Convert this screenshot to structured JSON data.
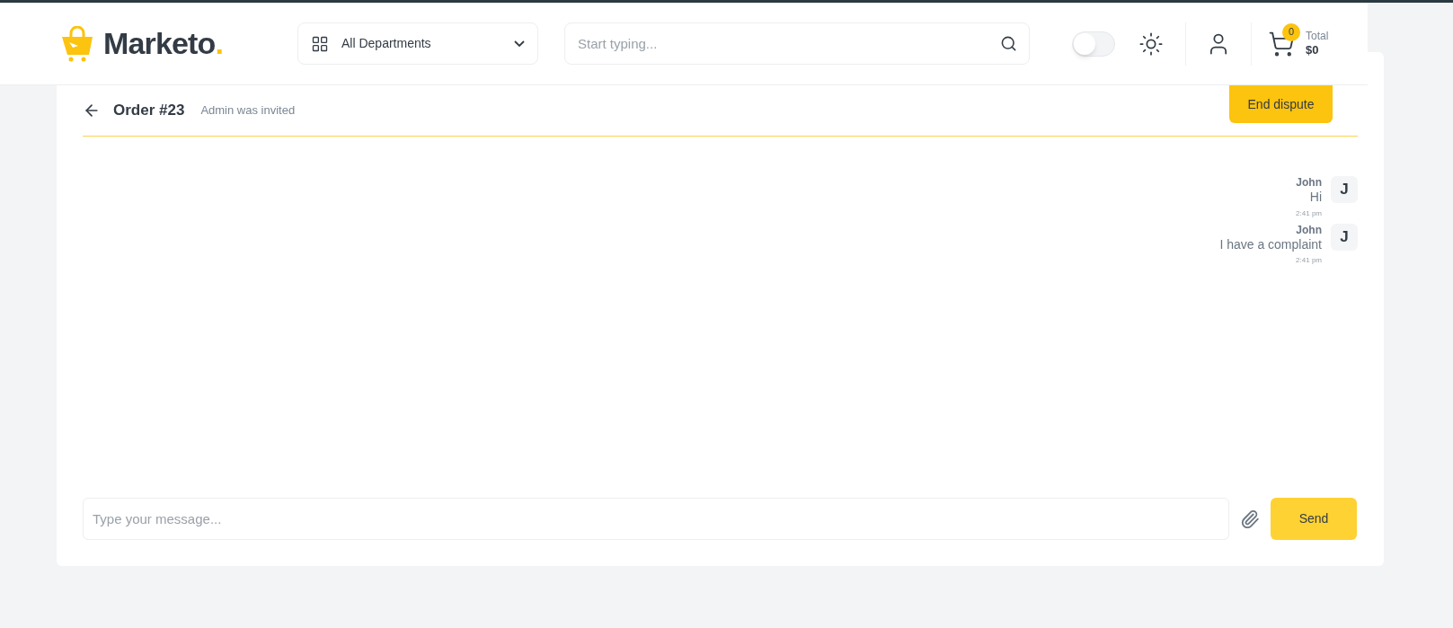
{
  "header": {
    "logo": "Marketo",
    "logo_dot": ".",
    "departments": {
      "label": "All Departments"
    },
    "search": {
      "placeholder": "Start typing..."
    },
    "theme_toggle": {
      "on": false
    },
    "cart": {
      "count": "0",
      "total_label": "Total",
      "total": "$0"
    }
  },
  "chat": {
    "title": "Order #23",
    "status": "Admin was invited",
    "end_button": "End dispute",
    "messages": [
      {
        "author": "John",
        "avatar": "J",
        "text": "Hi",
        "time": "2:41 pm"
      },
      {
        "author": "John",
        "avatar": "J",
        "text": "I have a complaint",
        "time": "2:41 pm"
      }
    ],
    "composer": {
      "placeholder": "Type your message...",
      "send": "Send"
    }
  }
}
